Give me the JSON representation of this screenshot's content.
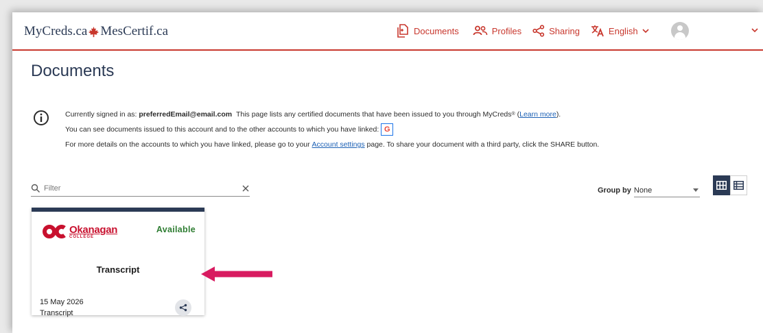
{
  "header": {
    "brand_left": "MyCreds.ca",
    "brand_right": "MesCertif.ca",
    "nav": {
      "documents": "Documents",
      "profiles": "Profiles",
      "sharing": "Sharing",
      "language": "English"
    }
  },
  "page": {
    "title": "Documents"
  },
  "info": {
    "signed_in_prefix": "Currently signed in as:",
    "email": "preferredEmail@email.com",
    "line1_text": "This page lists any certified documents that have been issued to you through MyCreds",
    "registered_mark": "®",
    "learn_more": "Learn more",
    "line2_text": "You can see documents issued to this account and to the other accounts to which you have linked:",
    "google_badge": "G",
    "line3_before": "For more details on the accounts to which you have linked, please go to your",
    "account_settings": "Account settings",
    "line3_after": "page. To share your document with a third party, click the SHARE button."
  },
  "filter": {
    "placeholder": "Filter"
  },
  "group_by": {
    "label": "Group by",
    "value": "None"
  },
  "card": {
    "institution_name": "Okanagan",
    "institution_sub": "COLLEGE",
    "status": "Available",
    "title": "Transcript",
    "date": "15 May 2026",
    "type": "Transcript"
  },
  "colors": {
    "brand_red": "#c8372d",
    "navy": "#2b3a55",
    "available_green": "#2e7d32",
    "arrow_pink": "#d81b60"
  }
}
